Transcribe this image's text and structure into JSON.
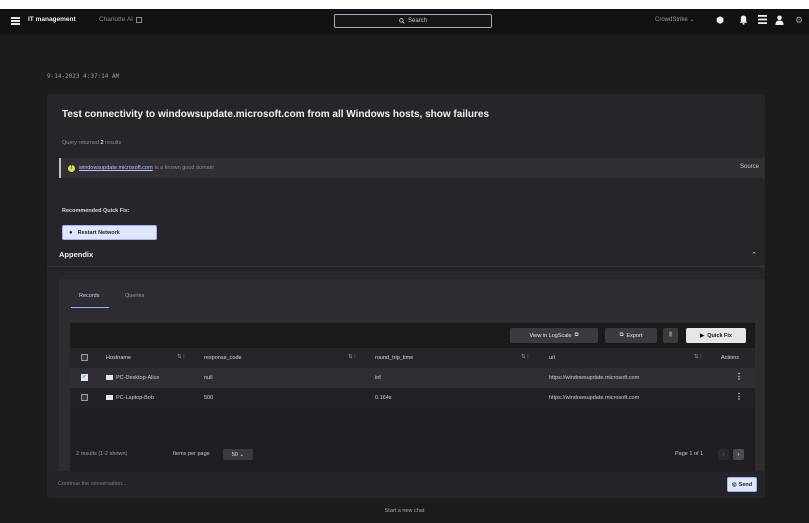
{
  "topbar": {
    "app_title": "IT management",
    "charlotte_label": "Charlotte AI",
    "search_label": "Search",
    "tenant": "CrowdStrike"
  },
  "conversation": {
    "timestamp": "9-14-2023 4:37:14 AM",
    "question": "Test connectivity to windowsupdate.microsoft.com from all Windows hosts, show failures",
    "query_returned_prefix": "Query returned",
    "query_returned_count": "2",
    "query_returned_suffix": "results",
    "info_link": "windowsupdate.microsoft.com",
    "info_text": "is a known good domain",
    "info_source": "Source",
    "quick_fix_label": "Recommended Quick Fix:",
    "quick_fix_button": "Restart Network"
  },
  "appendix": {
    "title": "Appendix",
    "tabs": [
      {
        "label": "Records",
        "active": true
      },
      {
        "label": "Queries",
        "active": false
      }
    ],
    "toolbar": {
      "view_logscale": "View in LogScale",
      "export": "Export",
      "quick_fix": "Quick Fix"
    },
    "columns": [
      "Hostname",
      "response_code",
      "round_trip_time",
      "url",
      "Actions"
    ],
    "rows": [
      {
        "checked": true,
        "hostname": "PC-Desktop-Alice",
        "response_code": "null",
        "round_trip_time": "inf",
        "url": "https://windowsupdate.microsoft.com"
      },
      {
        "checked": false,
        "hostname": "PC-Laptop-Bob",
        "response_code": "500",
        "round_trip_time": "0.164s",
        "url": "https://windowsupdate.microsoft.com"
      }
    ],
    "footer": {
      "results_count": "2 results",
      "results_shown": "(1-2 shown)",
      "items_per_page_label": "Items per page",
      "items_per_page_value": "50",
      "page_label": "Page 1 of 1"
    }
  },
  "chat": {
    "placeholder": "Continue the conversation...",
    "send_label": "Send",
    "new_chat": "Start a new chat"
  }
}
